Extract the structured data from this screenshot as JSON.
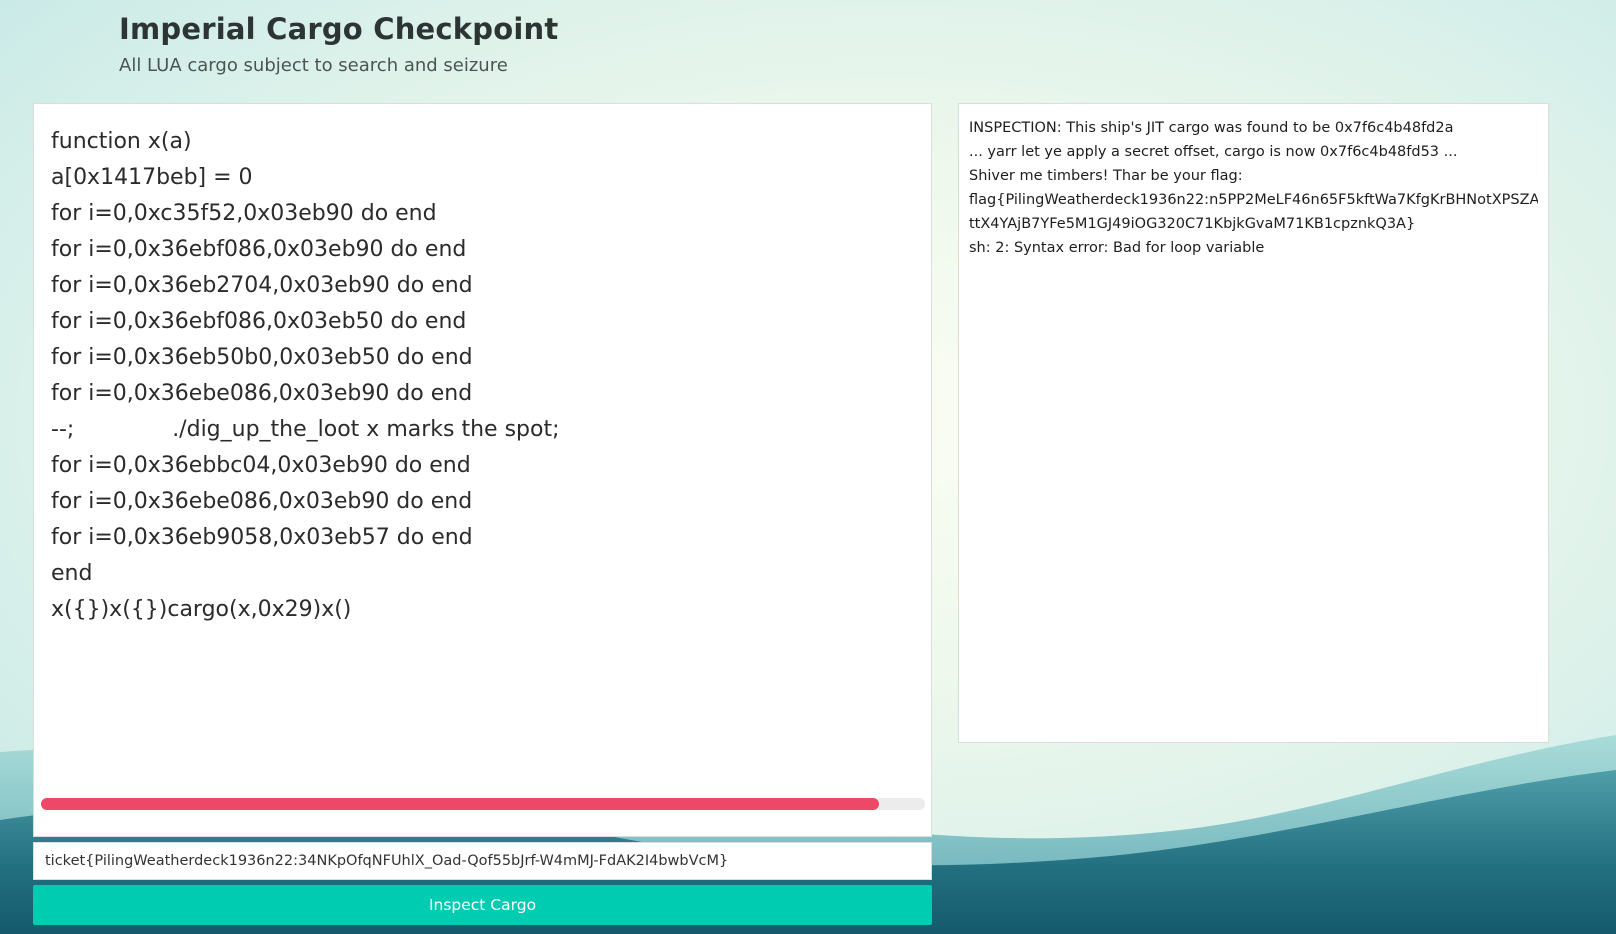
{
  "header": {
    "title": "Imperial Cargo Checkpoint",
    "subtitle": "All LUA cargo subject to search and seizure"
  },
  "editor": {
    "code": "function x(a)\na[0x1417beb] = 0\nfor i=0,0xc35f52,0x03eb90 do end\nfor i=0,0x36ebf086,0x03eb90 do end\nfor i=0,0x36eb2704,0x03eb90 do end\nfor i=0,0x36ebf086,0x03eb50 do end\nfor i=0,0x36eb50b0,0x03eb50 do end\nfor i=0,0x36ebe086,0x03eb90 do end\n--;              ./dig_up_the_loot x marks the spot;\nfor i=0,0x36ebbc04,0x03eb90 do end\nfor i=0,0x36ebe086,0x03eb90 do end\nfor i=0,0x36eb9058,0x03eb57 do end\nend\nx({})x({})cargo(x,0x29)x()",
    "horizontal_scroll_fraction": 0.948
  },
  "ticket": {
    "value": "ticket{PilingWeatherdeck1936n22:34NKpOfqNFUhlX_Oad-Qof55bJrf-W4mMJ-FdAK2I4bwbVcM}"
  },
  "inspect_button": {
    "label": "Inspect Cargo"
  },
  "output": {
    "lines": [
      "INSPECTION: This ship's JIT cargo was found to be 0x7f6c4b48fd2a",
      "... yarr let ye apply a secret offset, cargo is now 0x7f6c4b48fd53 ...",
      "Shiver me timbers! Thar be your flag:",
      "flag{PilingWeatherdeck1936n22:n5PP2MeLF46n65F5kftWa7KfgKrBHNotXPSZA",
      "ttX4YAjB7YFe5M1GJ49iOG320C71KbjkGvaM71KB1cpznkQ3A}",
      "sh: 2: Syntax error: Bad for loop variable"
    ]
  },
  "colors": {
    "accent_button": "#00ccb1",
    "scroll_thumb": "#ee4869",
    "wave_light": "#9fd3d3",
    "wave_dark": "#2d7c8c"
  }
}
